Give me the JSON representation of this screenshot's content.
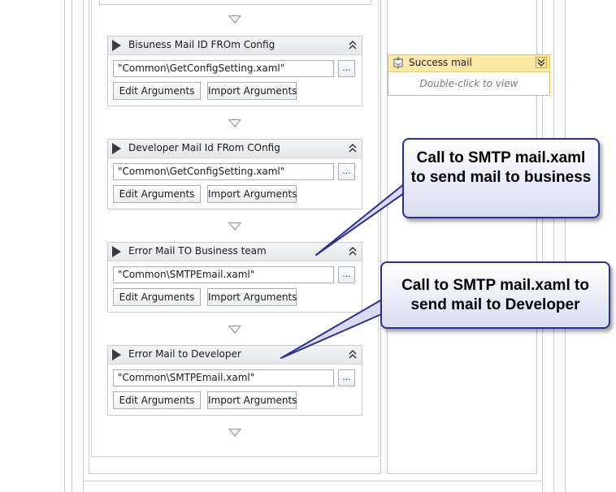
{
  "activities": [
    {
      "title": "Bisuness Mail ID FROm Config",
      "file": "\"Common\\GetConfigSetting.xaml\"",
      "browse": "...",
      "edit": "Edit Arguments",
      "import": "Import Arguments"
    },
    {
      "title": "Developer Mail Id FRom COnfig",
      "file": "\"Common\\GetConfigSetting.xaml\"",
      "browse": "...",
      "edit": "Edit Arguments",
      "import": "Import Arguments"
    },
    {
      "title": "Error Mail TO Business team",
      "file": "\"Common\\SMTPEmail.xaml\"",
      "browse": "...",
      "edit": "Edit Arguments",
      "import": "Import Arguments"
    },
    {
      "title": "Error Mail to Developer",
      "file": "\"Common\\SMTPEmail.xaml\"",
      "browse": "...",
      "edit": "Edit Arguments",
      "import": "Import Arguments"
    }
  ],
  "success_activity": {
    "title": "Success mail",
    "hint": "Double-click to view",
    "icon": "activity-icon"
  },
  "callouts": {
    "business": "Call to SMTP mail.xaml to send mail to business",
    "developer": "Call to SMTP mail.xaml to send mail to Developer"
  },
  "colors": {
    "callout_border": "#2b2f8c",
    "success_header": "#fde9a6",
    "activity_header": "#e8eaed"
  }
}
